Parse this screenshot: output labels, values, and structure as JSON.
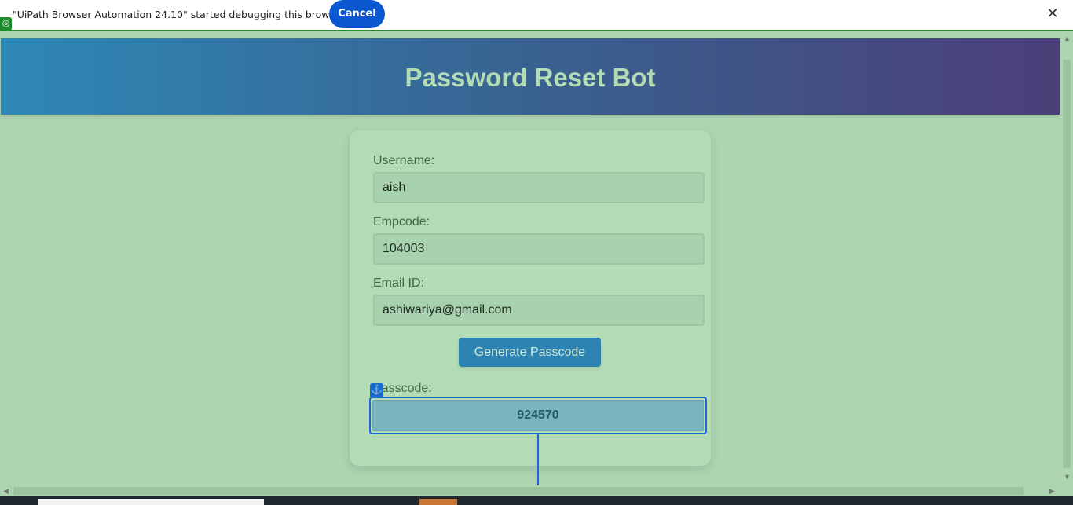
{
  "infobar": {
    "message": "\"UiPath Browser Automation 24.10\" started debugging this browser",
    "cancel_label": "Cancel",
    "close_icon": "close-icon"
  },
  "banner": {
    "title": "Password Reset Bot"
  },
  "form": {
    "username_label": "Username:",
    "username_value": "aish",
    "empcode_label": "Empcode:",
    "empcode_value": "104003",
    "email_label": "Email ID:",
    "email_value": "ashiwariya@gmail.com",
    "generate_button": "Generate Passcode",
    "passcode_label": "Passcode:",
    "passcode_value": "924570"
  },
  "colors": {
    "banner_start": "#2e88b6",
    "banner_end": "#4c3f78",
    "page_background": "#acd5b0",
    "button": "#2d84b3",
    "highlight": "#1769d8",
    "debug_green": "#1d8a2b"
  }
}
